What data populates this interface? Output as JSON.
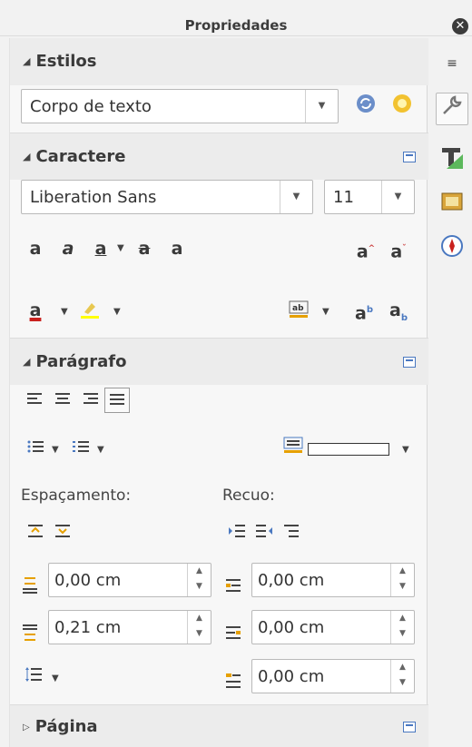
{
  "window": {
    "title": "Propriedades",
    "close_label": "✕"
  },
  "sidebar_tabs": [
    {
      "name": "menu",
      "glyph": "≡"
    },
    {
      "name": "properties",
      "glyph": "🔧"
    },
    {
      "name": "styles",
      "glyph": "T"
    },
    {
      "name": "gallery",
      "glyph": "▣"
    },
    {
      "name": "navigator",
      "glyph": "◎"
    }
  ],
  "estilos": {
    "title": "Estilos",
    "style_value": "Corpo de texto"
  },
  "caractere": {
    "title": "Caractere",
    "font_name": "Liberation Sans",
    "font_size": "11"
  },
  "paragrafo": {
    "title": "Parágrafo",
    "spacing_label": "Espaçamento:",
    "indent_label": "Recuo:",
    "above_spacing": "0,00 cm",
    "below_spacing": "0,21 cm",
    "before_indent": "0,00 cm",
    "after_indent": "0,00 cm",
    "first_line_indent": "0,00 cm"
  },
  "pagina": {
    "title": "Página"
  },
  "colors": {
    "font_color": "#c9211e",
    "highlight_color": "#ffff00",
    "accent": "#4a78c0"
  }
}
